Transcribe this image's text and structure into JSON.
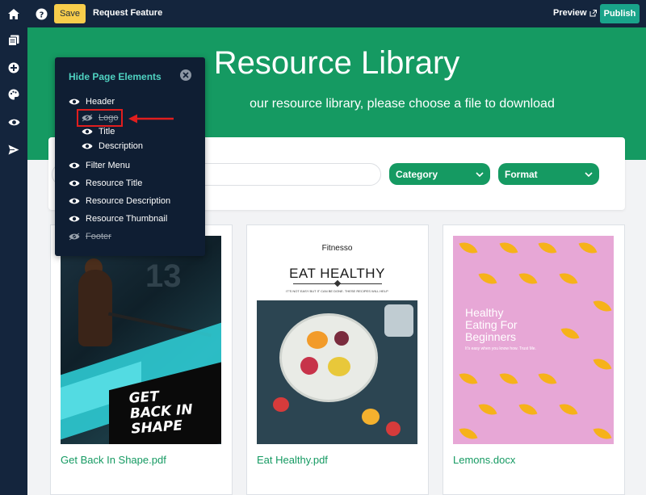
{
  "topbar": {
    "save_label": "Save",
    "request_feature_label": "Request Feature",
    "preview_label": "Preview",
    "publish_label": "Publish"
  },
  "page": {
    "title": "Resource Library",
    "subtitle": "our resource library, please choose a file to download"
  },
  "filters": {
    "category_label": "Category",
    "format_label": "Format"
  },
  "resources": [
    {
      "name": "Get Back In Shape.pdf",
      "thumb_text": [
        "GET",
        "BACK IN",
        "SHAPE"
      ],
      "thumb_number": "13"
    },
    {
      "name": "Eat Healthy.pdf",
      "thumb_brand": "Fitnesso",
      "thumb_title": "EAT HEALTHY",
      "thumb_small": "IT'S NOT EASY BUT IT CAN BE DONE. THESE RECIPES WILL HELP"
    },
    {
      "name": "Lemons.docx",
      "thumb_title": [
        "Healthy",
        "Eating For",
        "Beginners"
      ],
      "thumb_small": "It's easy when you know how. Trust Me."
    }
  ],
  "hide_panel": {
    "title": "Hide Page Elements",
    "items": [
      {
        "label": "Header",
        "hidden": false
      },
      {
        "label": "Logo",
        "hidden": true
      },
      {
        "label": "Title",
        "hidden": false
      },
      {
        "label": "Description",
        "hidden": false
      },
      {
        "label": "Filter Menu",
        "hidden": false
      },
      {
        "label": "Resource Title",
        "hidden": false
      },
      {
        "label": "Resource Description",
        "hidden": false
      },
      {
        "label": "Resource Thumbnail",
        "hidden": false
      },
      {
        "label": "Footer",
        "hidden": true
      }
    ]
  },
  "colors": {
    "topbar": "#14253d",
    "hero": "#159a62",
    "save": "#f7cd4b",
    "publish": "#19a48a",
    "panel": "#0f1e33",
    "panel_title": "#4fd2c1",
    "highlight": "#e01e1e"
  },
  "icons": {
    "rail": [
      "pages-icon",
      "add-icon",
      "palette-icon",
      "eye-icon",
      "send-icon"
    ],
    "top": [
      "home-icon",
      "help-icon",
      "external-link-icon"
    ]
  }
}
